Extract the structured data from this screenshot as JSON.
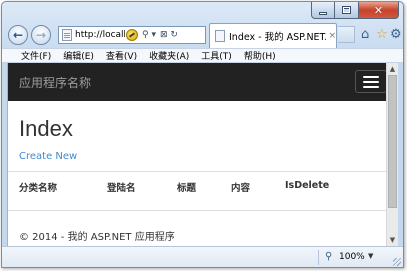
{
  "browser": {
    "address_url": "http://localho",
    "tab_title": "Index - 我的 ASP.NET...",
    "tab_close": "×",
    "minimize": "",
    "maximize": "",
    "close": "✕",
    "back": "←",
    "forward": "→",
    "search_tool": "⚲ ▾",
    "refresh_tool": "⊠ ↻"
  },
  "menu": [
    "文件(F)",
    "编辑(E)",
    "查看(V)",
    "收藏夹(A)",
    "工具(T)",
    "帮助(H)"
  ],
  "site": {
    "brand": "应用程序名称",
    "heading": "Index",
    "create_link": "Create New",
    "columns": [
      "分类名称",
      "登陆名",
      "标题",
      "内容",
      "IsDelete"
    ],
    "footer": "© 2014 - 我的 ASP.NET 应用程序"
  },
  "status": {
    "zoom": "100%",
    "zoom_dropdown": "▼"
  },
  "scrollbar": {
    "up": "▲",
    "down": "▼"
  }
}
